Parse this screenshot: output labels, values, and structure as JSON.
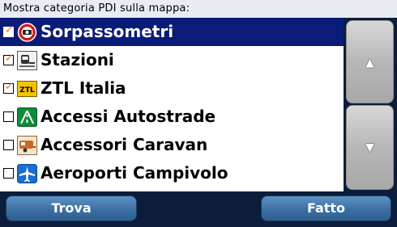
{
  "header": {
    "title": "Mostra categoria PDI sulla mappa:"
  },
  "list": {
    "items": [
      {
        "label": "Sorpassometri",
        "checked": true,
        "selected": true,
        "icon": "speed-camera-icon"
      },
      {
        "label": "Stazioni",
        "checked": true,
        "selected": false,
        "icon": "train-station-icon"
      },
      {
        "label": "ZTL Italia",
        "checked": true,
        "selected": false,
        "icon": "ztl-zone-icon",
        "icon_text": "ZTL"
      },
      {
        "label": "Accessi Autostrade",
        "checked": false,
        "selected": false,
        "icon": "motorway-access-icon"
      },
      {
        "label": "Accessori Caravan",
        "checked": false,
        "selected": false,
        "icon": "caravan-icon"
      },
      {
        "label": "Aeroporti Campivolo",
        "checked": false,
        "selected": false,
        "icon": "airplane-icon"
      }
    ]
  },
  "scroll": {
    "up_glyph": "▲",
    "down_glyph": "▼"
  },
  "buttons": {
    "find_label": "Trova",
    "done_label": "Fatto"
  },
  "colors": {
    "selected_row": "#0b1b78",
    "background": "#0b1d3a",
    "button": "#3c6fa2",
    "tick": "#e07a10"
  }
}
